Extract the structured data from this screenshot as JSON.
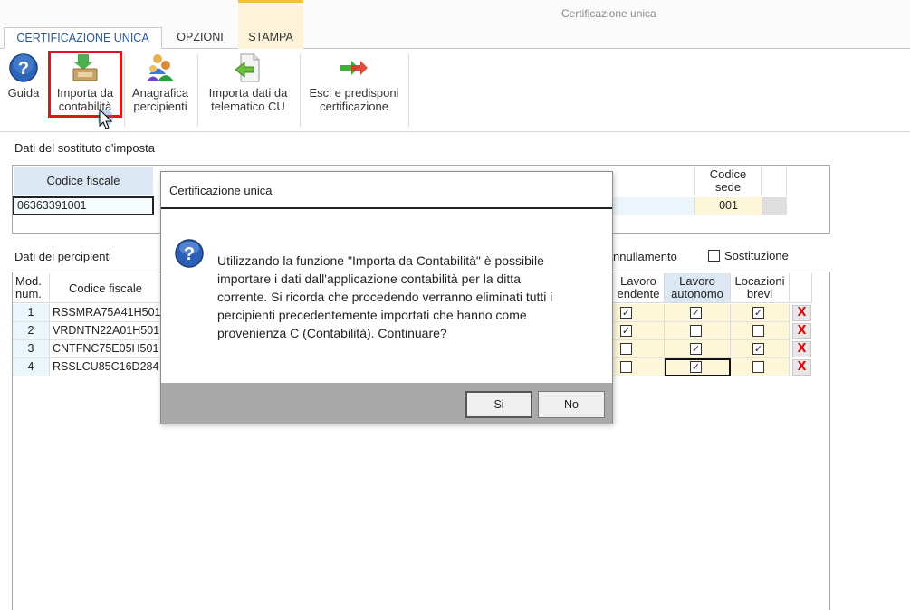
{
  "window": {
    "title": "Certificazione unica"
  },
  "tabs": [
    {
      "label": "CERTIFICAZIONE UNICA",
      "active": true
    },
    {
      "label": "OPZIONI"
    },
    {
      "label": "STAMPA"
    }
  ],
  "ribbon": {
    "guida": {
      "label": "Guida",
      "icon": "help-icon"
    },
    "importa_contabilita": {
      "line1": "Importa da",
      "line2": "contabilità",
      "icon": "import-accounting-icon"
    },
    "anagrafica": {
      "line1": "Anagrafica",
      "line2": "percipienti",
      "icon": "people-icon"
    },
    "importa_telematico": {
      "line1": "Importa dati da",
      "line2": "telematico CU",
      "icon": "import-document-icon"
    },
    "esci": {
      "line1": "Esci e predisponi",
      "line2": "certificazione",
      "icon": "exit-arrows-icon"
    }
  },
  "sostituto": {
    "section_title": "Dati del sostituto d'imposta",
    "codice_fiscale_label": "Codice fiscale",
    "codice_fiscale_value": "06363391001",
    "codice_sede_label_1": "Codice",
    "codice_sede_label_2": "sede",
    "codice_sede_value": "001"
  },
  "percipienti": {
    "section_title": "Dati dei percipienti",
    "annullamento_label": "nnullamento",
    "sostituzione_label": "Sostituzione",
    "sostituzione_checked": false,
    "headers": {
      "mod_1": "Mod.",
      "mod_2": "num.",
      "codice_fiscale": "Codice fiscale",
      "lavoro_dip_1": "Lavoro",
      "lavoro_dip_2": "endente",
      "lavoro_aut_1": "Lavoro",
      "lavoro_aut_2": "autonomo",
      "locazioni_1": "Locazioni",
      "locazioni_2": "brevi"
    },
    "rows": [
      {
        "num": "1",
        "cf": "RSSMRA75A41H501",
        "dip": "✓",
        "aut": "✓",
        "loc": "✓",
        "delete": "X"
      },
      {
        "num": "2",
        "cf": "VRDNTN22A01H501",
        "dip": "✓",
        "aut": "",
        "loc": "",
        "delete": "X"
      },
      {
        "num": "3",
        "cf": "CNTFNC75E05H501",
        "dip": "",
        "aut": "✓",
        "loc": "✓",
        "delete": "X"
      },
      {
        "num": "4",
        "cf": "RSSLCU85C16D284",
        "dip": "",
        "aut": "✓",
        "loc": "",
        "delete": "X"
      }
    ]
  },
  "dialog": {
    "title": "Certificazione unica",
    "icon": "question-icon",
    "message_lines": [
      "Utilizzando la funzione \"Importa da Contabilità\" è possibile",
      "importare i dati dall'applicazione contabilità per la ditta",
      "corrente. Si ricorda che procedendo verranno eliminati tutti i",
      "percipienti precedentemente importati che hanno come",
      "provenienza C (Contabilità). Continuare?"
    ],
    "yes_label": "Si",
    "no_label": "No"
  },
  "colors": {
    "highlight_box": "#e01616",
    "tab_active_text": "#2b5797",
    "header_blue": "#dbe7f3",
    "cell_yellow": "#fdf6d8",
    "delete_red": "#d01010"
  }
}
